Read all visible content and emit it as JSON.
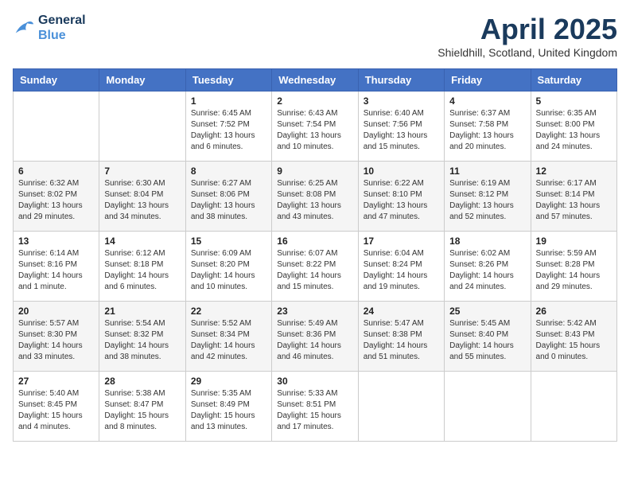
{
  "logo": {
    "line1": "General",
    "line2": "Blue"
  },
  "title": "April 2025",
  "location": "Shieldhill, Scotland, United Kingdom",
  "days_of_week": [
    "Sunday",
    "Monday",
    "Tuesday",
    "Wednesday",
    "Thursday",
    "Friday",
    "Saturday"
  ],
  "weeks": [
    [
      {
        "day": "",
        "info": ""
      },
      {
        "day": "",
        "info": ""
      },
      {
        "day": "1",
        "info": "Sunrise: 6:45 AM\nSunset: 7:52 PM\nDaylight: 13 hours and 6 minutes."
      },
      {
        "day": "2",
        "info": "Sunrise: 6:43 AM\nSunset: 7:54 PM\nDaylight: 13 hours and 10 minutes."
      },
      {
        "day": "3",
        "info": "Sunrise: 6:40 AM\nSunset: 7:56 PM\nDaylight: 13 hours and 15 minutes."
      },
      {
        "day": "4",
        "info": "Sunrise: 6:37 AM\nSunset: 7:58 PM\nDaylight: 13 hours and 20 minutes."
      },
      {
        "day": "5",
        "info": "Sunrise: 6:35 AM\nSunset: 8:00 PM\nDaylight: 13 hours and 24 minutes."
      }
    ],
    [
      {
        "day": "6",
        "info": "Sunrise: 6:32 AM\nSunset: 8:02 PM\nDaylight: 13 hours and 29 minutes."
      },
      {
        "day": "7",
        "info": "Sunrise: 6:30 AM\nSunset: 8:04 PM\nDaylight: 13 hours and 34 minutes."
      },
      {
        "day": "8",
        "info": "Sunrise: 6:27 AM\nSunset: 8:06 PM\nDaylight: 13 hours and 38 minutes."
      },
      {
        "day": "9",
        "info": "Sunrise: 6:25 AM\nSunset: 8:08 PM\nDaylight: 13 hours and 43 minutes."
      },
      {
        "day": "10",
        "info": "Sunrise: 6:22 AM\nSunset: 8:10 PM\nDaylight: 13 hours and 47 minutes."
      },
      {
        "day": "11",
        "info": "Sunrise: 6:19 AM\nSunset: 8:12 PM\nDaylight: 13 hours and 52 minutes."
      },
      {
        "day": "12",
        "info": "Sunrise: 6:17 AM\nSunset: 8:14 PM\nDaylight: 13 hours and 57 minutes."
      }
    ],
    [
      {
        "day": "13",
        "info": "Sunrise: 6:14 AM\nSunset: 8:16 PM\nDaylight: 14 hours and 1 minute."
      },
      {
        "day": "14",
        "info": "Sunrise: 6:12 AM\nSunset: 8:18 PM\nDaylight: 14 hours and 6 minutes."
      },
      {
        "day": "15",
        "info": "Sunrise: 6:09 AM\nSunset: 8:20 PM\nDaylight: 14 hours and 10 minutes."
      },
      {
        "day": "16",
        "info": "Sunrise: 6:07 AM\nSunset: 8:22 PM\nDaylight: 14 hours and 15 minutes."
      },
      {
        "day": "17",
        "info": "Sunrise: 6:04 AM\nSunset: 8:24 PM\nDaylight: 14 hours and 19 minutes."
      },
      {
        "day": "18",
        "info": "Sunrise: 6:02 AM\nSunset: 8:26 PM\nDaylight: 14 hours and 24 minutes."
      },
      {
        "day": "19",
        "info": "Sunrise: 5:59 AM\nSunset: 8:28 PM\nDaylight: 14 hours and 29 minutes."
      }
    ],
    [
      {
        "day": "20",
        "info": "Sunrise: 5:57 AM\nSunset: 8:30 PM\nDaylight: 14 hours and 33 minutes."
      },
      {
        "day": "21",
        "info": "Sunrise: 5:54 AM\nSunset: 8:32 PM\nDaylight: 14 hours and 38 minutes."
      },
      {
        "day": "22",
        "info": "Sunrise: 5:52 AM\nSunset: 8:34 PM\nDaylight: 14 hours and 42 minutes."
      },
      {
        "day": "23",
        "info": "Sunrise: 5:49 AM\nSunset: 8:36 PM\nDaylight: 14 hours and 46 minutes."
      },
      {
        "day": "24",
        "info": "Sunrise: 5:47 AM\nSunset: 8:38 PM\nDaylight: 14 hours and 51 minutes."
      },
      {
        "day": "25",
        "info": "Sunrise: 5:45 AM\nSunset: 8:40 PM\nDaylight: 14 hours and 55 minutes."
      },
      {
        "day": "26",
        "info": "Sunrise: 5:42 AM\nSunset: 8:43 PM\nDaylight: 15 hours and 0 minutes."
      }
    ],
    [
      {
        "day": "27",
        "info": "Sunrise: 5:40 AM\nSunset: 8:45 PM\nDaylight: 15 hours and 4 minutes."
      },
      {
        "day": "28",
        "info": "Sunrise: 5:38 AM\nSunset: 8:47 PM\nDaylight: 15 hours and 8 minutes."
      },
      {
        "day": "29",
        "info": "Sunrise: 5:35 AM\nSunset: 8:49 PM\nDaylight: 15 hours and 13 minutes."
      },
      {
        "day": "30",
        "info": "Sunrise: 5:33 AM\nSunset: 8:51 PM\nDaylight: 15 hours and 17 minutes."
      },
      {
        "day": "",
        "info": ""
      },
      {
        "day": "",
        "info": ""
      },
      {
        "day": "",
        "info": ""
      }
    ]
  ]
}
